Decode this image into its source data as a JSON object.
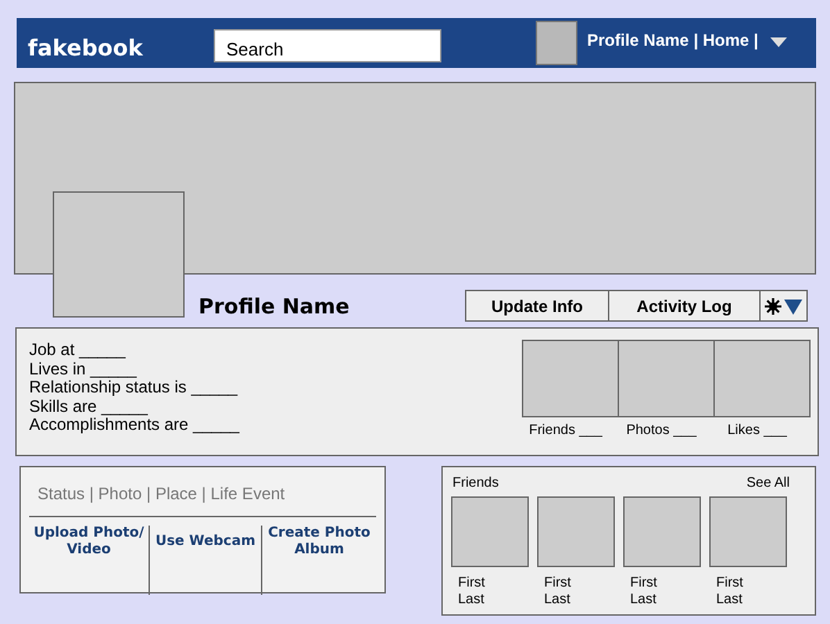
{
  "header": {
    "logo": "fakebook",
    "search": {
      "placeholder": "Search"
    },
    "nav": "Profile Name | Home |"
  },
  "profile": {
    "name": "Profile Name",
    "buttons": [
      "Update Info",
      "Activity Log"
    ]
  },
  "about": [
    "Job at _____",
    "Lives in _____",
    "Relationship status is _____",
    "Skills are _____",
    "Accomplishments are _____"
  ],
  "stats": [
    "Friends ___",
    "Photos ___",
    "Likes ___"
  ],
  "composer": {
    "tabs": "Status | Photo | Place | Life Event",
    "actions": [
      "Upload Photo/ Video",
      "Use Webcam",
      "Create Photo Album"
    ]
  },
  "friends": {
    "title": "Friends",
    "see_all": "See All",
    "items": [
      {
        "name": "First Last"
      },
      {
        "name": "First Last"
      },
      {
        "name": "First Last"
      },
      {
        "name": "First Last"
      }
    ]
  }
}
